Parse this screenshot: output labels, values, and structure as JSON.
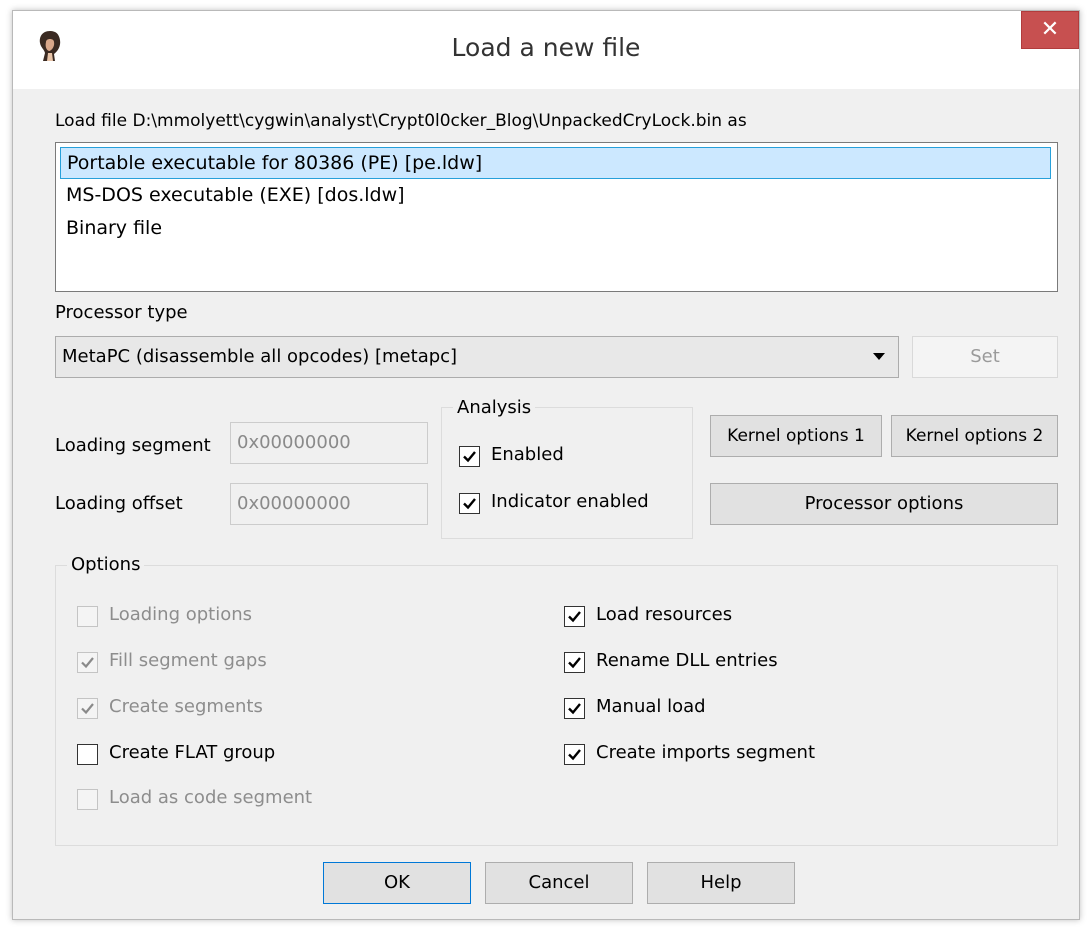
{
  "window": {
    "title": "Load a new file",
    "close_glyph": "✕",
    "icon": "ida-app-icon"
  },
  "load_file_label": "Load file D:\\mmolyett\\cygwin\\analyst\\Crypt0l0cker_Blog\\UnpackedCryLock.bin as",
  "loaders": {
    "items": [
      {
        "label": "Portable executable for 80386 (PE) [pe.ldw]",
        "selected": true
      },
      {
        "label": "MS-DOS executable (EXE) [dos.ldw]",
        "selected": false
      },
      {
        "label": "Binary file",
        "selected": false
      }
    ]
  },
  "processor": {
    "label": "Processor type",
    "selected": "MetaPC (disassemble all opcodes) [metapc]",
    "set_label": "Set"
  },
  "segment": {
    "loading_segment_label": "Loading segment",
    "loading_segment_value": "0x00000000",
    "loading_offset_label": "Loading offset",
    "loading_offset_value": "0x00000000"
  },
  "analysis": {
    "title": "Analysis",
    "enabled_label": "Enabled",
    "indicator_label": "Indicator enabled"
  },
  "buttons": {
    "kernel1": "Kernel options 1",
    "kernel2": "Kernel options 2",
    "processor_options": "Processor options",
    "ok": "OK",
    "cancel": "Cancel",
    "help": "Help"
  },
  "options": {
    "title": "Options",
    "left": [
      {
        "label": "Loading options",
        "checked": false,
        "disabled": true
      },
      {
        "label": "Fill segment gaps",
        "checked": true,
        "disabled": true
      },
      {
        "label": "Create segments",
        "checked": true,
        "disabled": true
      },
      {
        "label": "Create FLAT group",
        "checked": false,
        "disabled": false
      },
      {
        "label": "Load as code segment",
        "checked": false,
        "disabled": true
      }
    ],
    "right": [
      {
        "label": "Load resources",
        "checked": true,
        "disabled": false
      },
      {
        "label": "Rename DLL entries",
        "checked": true,
        "disabled": false
      },
      {
        "label": "Manual load",
        "checked": true,
        "disabled": false
      },
      {
        "label": "Create imports segment",
        "checked": true,
        "disabled": false
      }
    ]
  },
  "colors": {
    "dialog_bg": "#f0f0f0",
    "selection_bg": "#cce8ff",
    "selection_border": "#26a0da",
    "close_red": "#c75050",
    "disabled_text": "#8d8d8d"
  }
}
